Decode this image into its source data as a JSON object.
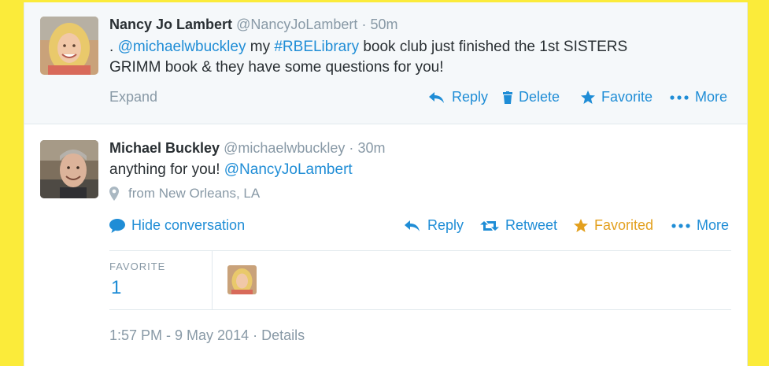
{
  "tweet1": {
    "name": "Nancy Jo Lambert",
    "handle": "@NancyJoLambert",
    "separator": "·",
    "time": "50m",
    "text_prefix": ".",
    "mention": "@michaelwbuckley",
    "text_mid": "my",
    "hashtag": "#RBELibrary",
    "text_rest": "book club just finished the 1st SISTERS",
    "text_line2": "GRIMM book & they have some questions for you!",
    "expand_label": "Expand",
    "actions": {
      "reply": "Reply",
      "delete": "Delete",
      "favorite": "Favorite",
      "more": "More"
    }
  },
  "tweet2": {
    "name": "Michael Buckley",
    "handle": "@michaelwbuckley",
    "separator": "·",
    "time": "30m",
    "text": "anything for you!",
    "mention": "@NancyJoLambert",
    "location": "from New Orleans, LA",
    "hide_conversation": "Hide conversation",
    "actions": {
      "reply": "Reply",
      "retweet": "Retweet",
      "favorited": "Favorited",
      "more": "More"
    },
    "stats": {
      "favorite_label": "FAVORITE",
      "favorite_count": "1"
    },
    "timestamp": "1:57 PM - 9 May 2014",
    "details": "Details"
  },
  "colors": {
    "link": "#1f8dd6",
    "favorited": "#e3a01e",
    "muted": "#8899a6",
    "background": "#fbeb3a"
  }
}
